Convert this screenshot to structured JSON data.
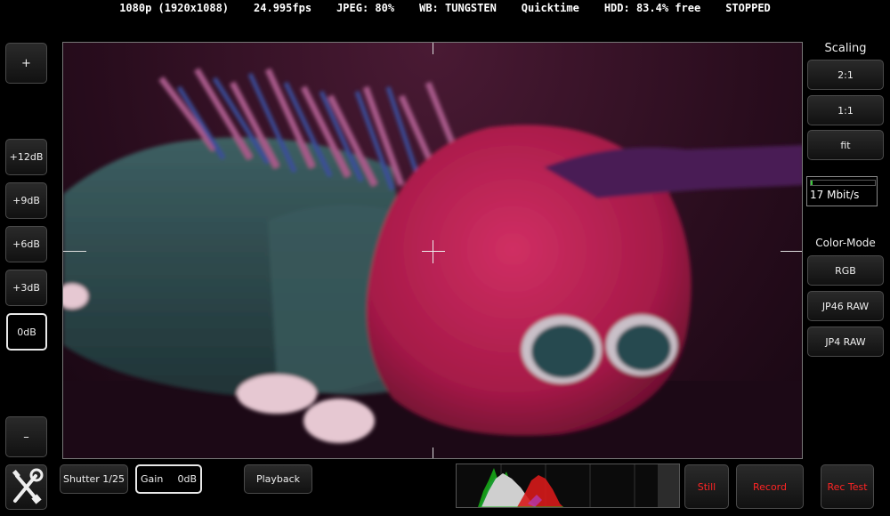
{
  "status": {
    "resolution": "1080p (1920x1088)",
    "fps": "24.995fps",
    "jpeg": "JPEG: 80%",
    "wb": "WB: TUNGSTEN",
    "container": "Quicktime",
    "hdd": "HDD: 83.4% free",
    "state": "STOPPED"
  },
  "left_panel": {
    "plus_label": "+",
    "gain_options": [
      "+12dB",
      "+9dB",
      "+6dB",
      "+3dB",
      "0dB"
    ],
    "selected_gain": "0dB",
    "minus_label": "–"
  },
  "right_panel": {
    "scaling_title": "Scaling",
    "scaling_options": [
      "2:1",
      "1:1",
      "fit"
    ],
    "bitrate_text": "17 Mbit/s",
    "bitrate_level": 0.03,
    "color_mode_title": "Color-Mode",
    "color_modes": [
      "RGB",
      "JP46 RAW",
      "JP4 RAW"
    ]
  },
  "bottom_bar": {
    "shutter_label": "Shutter 1/25",
    "gain_label": "Gain",
    "gain_value": "0dB",
    "playback_label": "Playback",
    "still_label": "Still",
    "record_label": "Record",
    "rec_test_label": "Rec Test"
  },
  "icons": {
    "tools": "wrench-screwdriver-icon"
  },
  "colors": {
    "accent_red": "#ff2424",
    "bitrate_green": "#3cc83c",
    "hist_red": "#d61a1a",
    "hist_green": "#19b219",
    "hist_blue": "#2b2bd6",
    "hist_luma": "#cfcfcf"
  }
}
